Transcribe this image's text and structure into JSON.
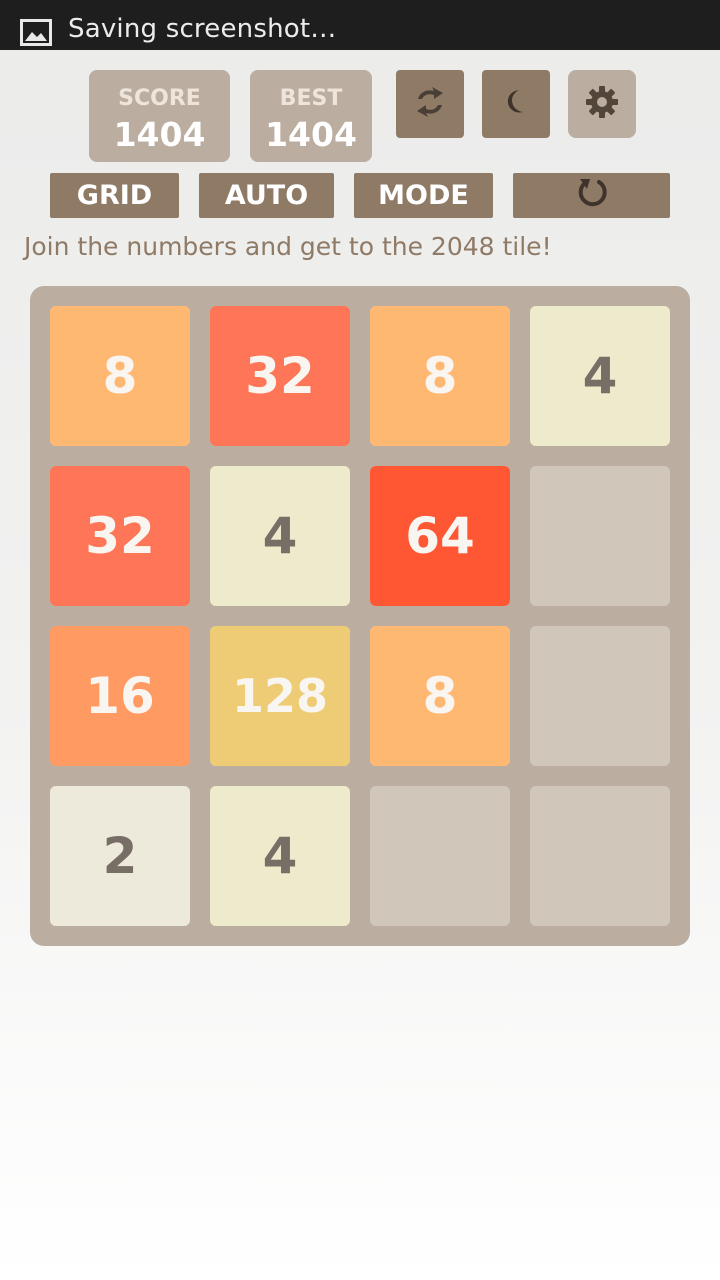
{
  "statusbar": {
    "notification_icon": "image-icon",
    "text": "Saving screenshot…"
  },
  "header": {
    "score_label": "SCORE",
    "score_value": "1404",
    "best_label": "BEST",
    "best_value": "1404",
    "icon_buttons": [
      "swap-arrows-icon",
      "moon-icon",
      "gear-icon"
    ]
  },
  "toolbar": {
    "grid_label": "GRID",
    "auto_label": "AUTO",
    "mode_label": "MODE",
    "undo_icon": "undo-icon"
  },
  "tagline": "Join the numbers and get to the 2048 tile!",
  "board": {
    "size": 4,
    "rows": [
      [
        8,
        32,
        8,
        4
      ],
      [
        32,
        4,
        64,
        null
      ],
      [
        16,
        128,
        8,
        null
      ],
      [
        2,
        4,
        null,
        null
      ]
    ]
  },
  "tile_colors": {
    "2": {
      "bg": "#eeeadb",
      "fg": "#776e65"
    },
    "4": {
      "bg": "#eeebcd",
      "fg": "#776e65"
    },
    "8": {
      "bg": "#ffb872",
      "fg": "#f9f6f2"
    },
    "16": {
      "bg": "#ff9a63",
      "fg": "#f9f6f2"
    },
    "32": {
      "bg": "#ff7557",
      "fg": "#f9f6f2"
    },
    "64": {
      "bg": "#ff5733",
      "fg": "#f9f6f2"
    },
    "128": {
      "bg": "#edcc75",
      "fg": "#f9f6f2"
    }
  },
  "colors": {
    "accent_button": "#8f7a66",
    "score_box": "#bbada0",
    "board": "#bbada0"
  }
}
